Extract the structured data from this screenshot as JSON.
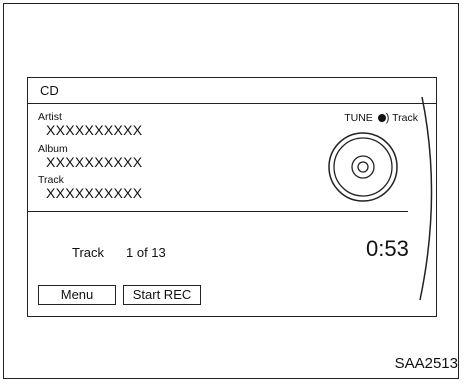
{
  "screen": {
    "title": "CD",
    "artist_label": "Artist",
    "artist_value": "XXXXXXXXXX",
    "album_label": "Album",
    "album_value": "XXXXXXXXXX",
    "track_label": "Track",
    "track_value": "XXXXXXXXXX",
    "tune_label": "TUNE",
    "tune_suffix": "Track",
    "track_position_label": "Track",
    "track_position_value": "1 of 13",
    "elapsed_time": "0:53",
    "buttons": {
      "menu": "Menu",
      "start_rec": "Start REC"
    }
  },
  "figure_code": "SAA2513",
  "icons": [
    "disc-icon",
    "tune-knob-icon"
  ]
}
